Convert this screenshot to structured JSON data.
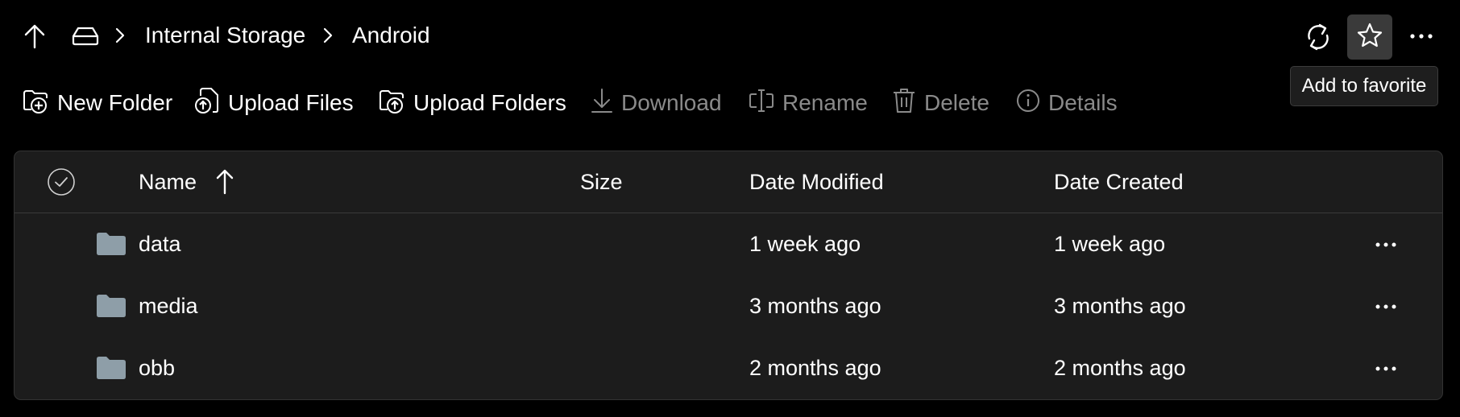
{
  "breadcrumb": {
    "items": [
      "Internal Storage",
      "Android"
    ],
    "up_icon": "arrow-up-icon",
    "drive_icon": "drive-icon",
    "separator_icon": "chevron-right-icon"
  },
  "top_actions": {
    "refresh_icon": "refresh-icon",
    "favorite_icon": "star-icon",
    "more_icon": "more-horizontal-icon",
    "tooltip": "Add to favorite"
  },
  "commands": [
    {
      "label": "New Folder",
      "icon": "new-folder-icon",
      "enabled": true
    },
    {
      "label": "Upload Files",
      "icon": "upload-file-icon",
      "enabled": true
    },
    {
      "label": "Upload Folders",
      "icon": "upload-folder-icon",
      "enabled": true
    },
    {
      "label": "Download",
      "icon": "download-icon",
      "enabled": false
    },
    {
      "label": "Rename",
      "icon": "rename-icon",
      "enabled": false
    },
    {
      "label": "Delete",
      "icon": "delete-icon",
      "enabled": false
    },
    {
      "label": "Details",
      "icon": "info-icon",
      "enabled": false
    }
  ],
  "table": {
    "columns": {
      "name": "Name",
      "size": "Size",
      "modified": "Date Modified",
      "created": "Date Created"
    },
    "sort_icon": "sort-ascending-icon",
    "select_all_icon": "checkmark-circle-icon",
    "rows": [
      {
        "name": "data",
        "size": "",
        "modified": "1 week ago",
        "created": "1 week ago",
        "icon": "folder-icon"
      },
      {
        "name": "media",
        "size": "",
        "modified": "3 months ago",
        "created": "3 months ago",
        "icon": "folder-icon"
      },
      {
        "name": "obb",
        "size": "",
        "modified": "2 months ago",
        "created": "2 months ago",
        "icon": "folder-icon"
      }
    ]
  },
  "colors": {
    "background": "#000000",
    "panel": "#1c1c1c",
    "folder": "#8e9ea8",
    "disabled_text": "#8a8a8a",
    "highlight": "#3a3a3a"
  }
}
